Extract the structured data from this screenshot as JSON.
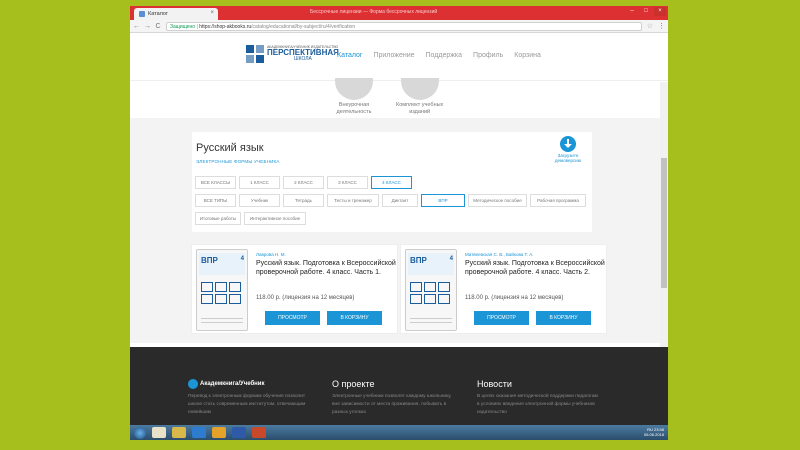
{
  "browser": {
    "tab_title": "Каталог",
    "tab_close": "×",
    "inactive_tab": "Бессрочные лицензии — Форма бессрочных лицензий",
    "address": {
      "secure_label": "Защищено",
      "url_host": "https://shop-akbooks.ru",
      "url_path": "/catalog/educational/by-subject/ru/4/verification"
    },
    "nav": {
      "back": "←",
      "forward": "→",
      "reload": "C",
      "star": "☆",
      "menu": "⋮"
    },
    "window_controls": {
      "minimize": "–",
      "maximize": "□",
      "close": "×"
    }
  },
  "site": {
    "logo": {
      "small": "АКАДЕМКНИГА/УЧЕБНИК ИЗДАТЕЛЬСТВО",
      "big": "ПЕРСПЕКТИВНАЯ",
      "sub": "ШКОЛА"
    },
    "nav": [
      {
        "label": "Каталог",
        "active": true
      },
      {
        "label": "Приложение",
        "active": false
      },
      {
        "label": "Поддержка",
        "active": false
      },
      {
        "label": "Профиль",
        "active": false
      },
      {
        "label": "Корзина",
        "active": false
      }
    ],
    "categories": [
      {
        "label_line1": "Внеурочная",
        "label_line2": "деятельность"
      },
      {
        "label_line1": "Комплект учебных",
        "label_line2": "изданий"
      }
    ]
  },
  "catalog": {
    "title": "Русский язык",
    "subtitle": "ЭЛЕКТРОННЫЕ ФОРМЫ УЧЕБНИКА",
    "download": {
      "line1": "Загрузите",
      "line2": "демоверсию"
    },
    "grades": [
      "ВСЕ КЛАССЫ",
      "1 КЛАСС",
      "2 КЛАСС",
      "3 КЛАСС",
      "4 КЛАСС"
    ],
    "active_grade_index": 4,
    "types": [
      "ВСЕ ТИПЫ",
      "Учебник",
      "Тетрадь",
      "Тесты и тренажер",
      "Диктант",
      "ВПР",
      "Методическое пособие",
      "Рабочая программа"
    ],
    "active_type_index": 5,
    "types_row2": [
      "Итоговые работы",
      "Интерактивное пособие"
    ]
  },
  "products": [
    {
      "author": "Лаврова Н. М.",
      "title": "Русский язык. Подготовка к Всероссийской проверочной работе. 4 класс. Часть 1.",
      "price": "118.00 р. (лицензия на 12 месяцев)",
      "cover_label": "ВПР",
      "cover_number": "4",
      "view_label": "ПРОСМОТР",
      "cart_label": "В КОРЗИНУ"
    },
    {
      "author": "Матвеевская С. В., Байкова Т. А.",
      "title": "Русский язык. Подготовка к Всероссийской проверочной работе. 4 класс. Часть 2.",
      "price": "118.00 р. (лицензия на 12 месяцев)",
      "cover_label": "ВПР",
      "cover_number": "4",
      "view_label": "ПРОСМОТР",
      "cart_label": "В КОРЗИНУ"
    }
  ],
  "footer": {
    "brand": "Академкнига/Учебник",
    "brand_text": "Перевод к электронным формам обучения позволит школе стать современным институтом, отвечающим новейшим",
    "about_title": "О проекте",
    "about_text": "Электронные учебники позволят каждому школьнику, вне зависимости от места проживания, побывать в разных уголках",
    "news_title": "Новости",
    "news_text": "В целях оказания методической поддержки педагогам в условиях введения электронной формы учебников издательство"
  },
  "taskbar": {
    "time": "23:58",
    "date": "06.06.2018",
    "lang": "RU"
  },
  "colors": {
    "accent": "#1b95d6",
    "brand": "#1b5c9c",
    "chrome_red": "#dd3033",
    "slide_bg": "#a6bf1d"
  }
}
